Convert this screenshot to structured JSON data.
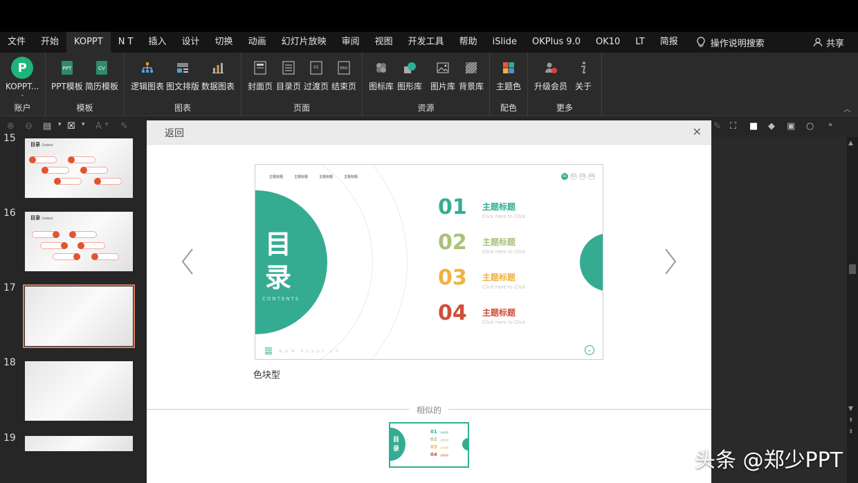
{
  "menu": {
    "tabs": [
      "文件",
      "开始",
      "KOPPT",
      "N T",
      "插入",
      "设计",
      "切换",
      "动画",
      "幻灯片放映",
      "审阅",
      "视图",
      "开发工具",
      "帮助",
      "iSlide",
      "OKPlus 9.0",
      "OK10",
      "LT",
      "简报"
    ],
    "active_tab": "KOPPT",
    "search_label": "操作说明搜索",
    "share_label": "共享"
  },
  "ribbon": {
    "account": {
      "button": "KOPPT...",
      "group": "账户"
    },
    "template": {
      "buttons": [
        "PPT模板",
        "简历模板"
      ],
      "group": "模板"
    },
    "chart": {
      "buttons": [
        "逻辑图表",
        "图文排版",
        "数据图表"
      ],
      "group": "图表"
    },
    "page": {
      "buttons": [
        "封面页",
        "目录页",
        "过渡页",
        "结束页"
      ],
      "group": "页面"
    },
    "resource": {
      "buttons": [
        "图标库",
        "图形库",
        "图片库",
        "背景库"
      ],
      "group": "资源"
    },
    "color": {
      "buttons": [
        "主题色"
      ],
      "group": "配色"
    },
    "more": {
      "buttons": [
        "升级会员",
        "关于"
      ],
      "group": "更多"
    }
  },
  "slides": {
    "numbers": [
      "15",
      "16",
      "17",
      "18",
      "19"
    ],
    "thumb_title": "目录",
    "thumb_subtitle": "Content",
    "selected": "17"
  },
  "dialog": {
    "back_label": "返回",
    "close_label": "✕",
    "template_name": "色块型",
    "similar_label": "相似的"
  },
  "preview": {
    "nav_items": [
      "主题标题",
      "主题标题",
      "主题标题",
      "主题标题"
    ],
    "big_char_1": "目",
    "big_char_2": "录",
    "contents_label": "CONTENTS",
    "items": [
      {
        "num": "01",
        "title": "主题标题",
        "sub": "Click here to Click",
        "color": "#35ac92"
      },
      {
        "num": "02",
        "title": "主题标题",
        "sub": "Click here to Click",
        "color": "#a9c17a"
      },
      {
        "num": "03",
        "title": "主题标题",
        "sub": "Click here to Click",
        "color": "#f0b23c"
      },
      {
        "num": "04",
        "title": "主题标题",
        "sub": "Click here to Click",
        "color": "#cf4e3a"
      }
    ],
    "dots": [
      "01",
      "02",
      "03",
      "04"
    ],
    "url": "www.koppt.cn",
    "accent": "#35ac92"
  },
  "watermark": "头条 @郑少PPT"
}
